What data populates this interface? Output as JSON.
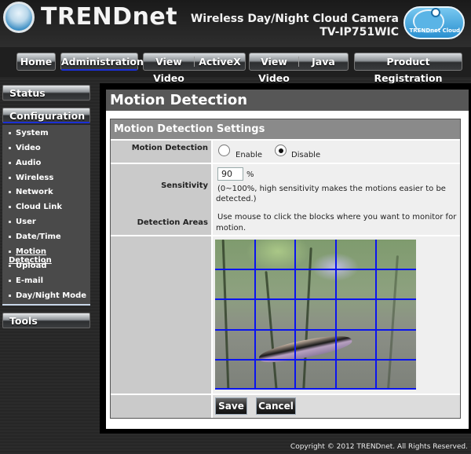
{
  "header": {
    "brand": "TRENDnet",
    "product_name": "Wireless Day/Night Cloud Camera",
    "model": "TV-IP751WIC",
    "cloud_badge": "TRENDnet Cloud"
  },
  "nav": {
    "home": "Home",
    "administration": "Administration",
    "view_video_activex": [
      "View Video",
      "ActiveX"
    ],
    "view_video_java": [
      "View Video",
      "Java"
    ],
    "product_registration": "Product Registration",
    "active": "Administration"
  },
  "sidebar": {
    "status": "Status",
    "configuration": "Configuration",
    "tools": "Tools",
    "items": [
      {
        "label": "System"
      },
      {
        "label": "Video"
      },
      {
        "label": "Audio"
      },
      {
        "label": "Wireless"
      },
      {
        "label": "Network"
      },
      {
        "label": "Cloud Link"
      },
      {
        "label": "User"
      },
      {
        "label": "Date/Time"
      },
      {
        "label": "Motion Detection",
        "current": true
      },
      {
        "label": "Upload"
      },
      {
        "label": "E-mail"
      },
      {
        "label": "Day/Night Mode"
      }
    ]
  },
  "main": {
    "title": "Motion Detection",
    "section_title": "Motion Detection Settings",
    "motion_detection": {
      "label": "Motion Detection",
      "options": [
        "Enable",
        "Disable"
      ],
      "selected": "Disable"
    },
    "sensitivity": {
      "label": "Sensitivity",
      "value": "90",
      "unit": "%",
      "hint_line1": "(0~100%, high sensitivity makes the motions easier to be",
      "hint_line2": "detected.)"
    },
    "detection_areas": {
      "label": "Detection Areas",
      "hint_line1": "Use mouse to click the blocks where you want to monitor for",
      "hint_line2": "motion.",
      "grid_rows": 5,
      "grid_cols": 5,
      "grid_color": "#0a14f0"
    },
    "save": "Save",
    "cancel": "Cancel"
  },
  "footer": {
    "copyright": "Copyright © 2012 TRENDnet.  All Rights Reserved."
  }
}
